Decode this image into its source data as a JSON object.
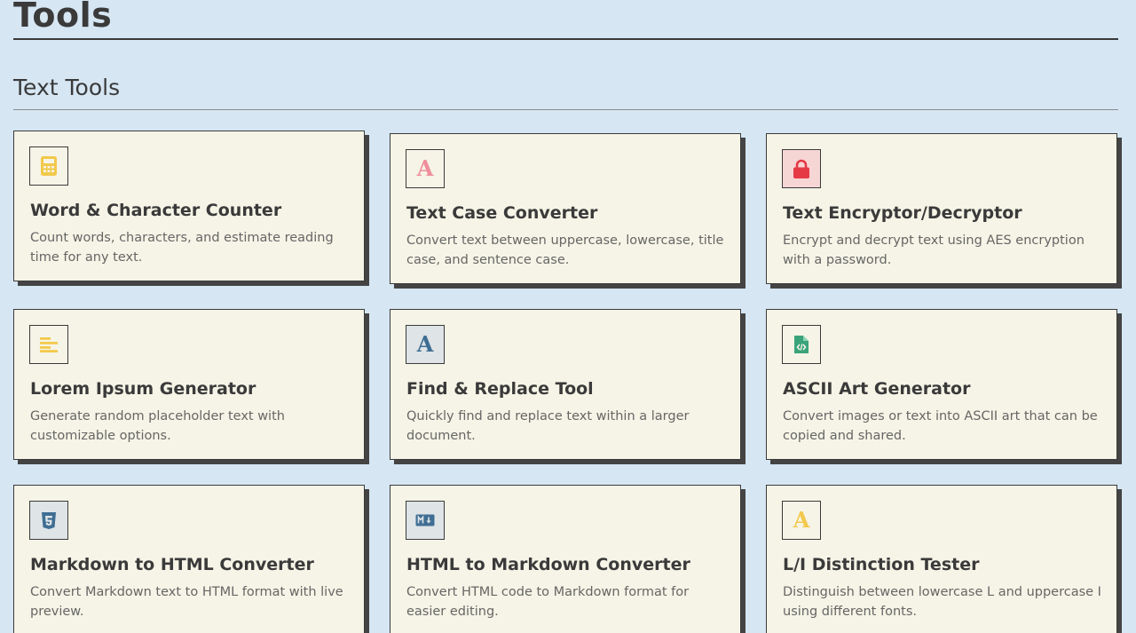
{
  "page": {
    "title": "Tools"
  },
  "section": {
    "title": "Text Tools"
  },
  "colors": {
    "background": "#d6e6f3",
    "card_background": "#f6f4e6",
    "border": "#3a3a3a",
    "icon_yellow": "#f2c94c",
    "icon_pink": "#ef8e9c",
    "icon_red": "#e63946",
    "icon_blue": "#3f6e94",
    "icon_green": "#3aa37a"
  },
  "tools": [
    {
      "title": "Word & Character Counter",
      "description": "Count words, characters, and estimate reading time for any text.",
      "icon": "calculator-icon"
    },
    {
      "title": "Text Case Converter",
      "description": "Convert text between uppercase, lowercase, title case, and sentence case.",
      "icon": "letter-a-icon"
    },
    {
      "title": "Text Encryptor/Decryptor",
      "description": "Encrypt and decrypt text using AES encryption with a password.",
      "icon": "lock-icon"
    },
    {
      "title": "Lorem Ipsum Generator",
      "description": "Generate random placeholder text with customizable options.",
      "icon": "align-left-icon"
    },
    {
      "title": "Find & Replace Tool",
      "description": "Quickly find and replace text within a larger document.",
      "icon": "letter-a-icon"
    },
    {
      "title": "ASCII Art Generator",
      "description": "Convert images or text into ASCII art that can be copied and shared.",
      "icon": "code-file-icon"
    },
    {
      "title": "Markdown to HTML Converter",
      "description": "Convert Markdown text to HTML format with live preview.",
      "icon": "html5-icon"
    },
    {
      "title": "HTML to Markdown Converter",
      "description": "Convert HTML code to Markdown format for easier editing.",
      "icon": "markdown-icon"
    },
    {
      "title": "L/I Distinction Tester",
      "description": "Distinguish between lowercase L and uppercase I using different fonts.",
      "icon": "letter-a-icon"
    }
  ]
}
